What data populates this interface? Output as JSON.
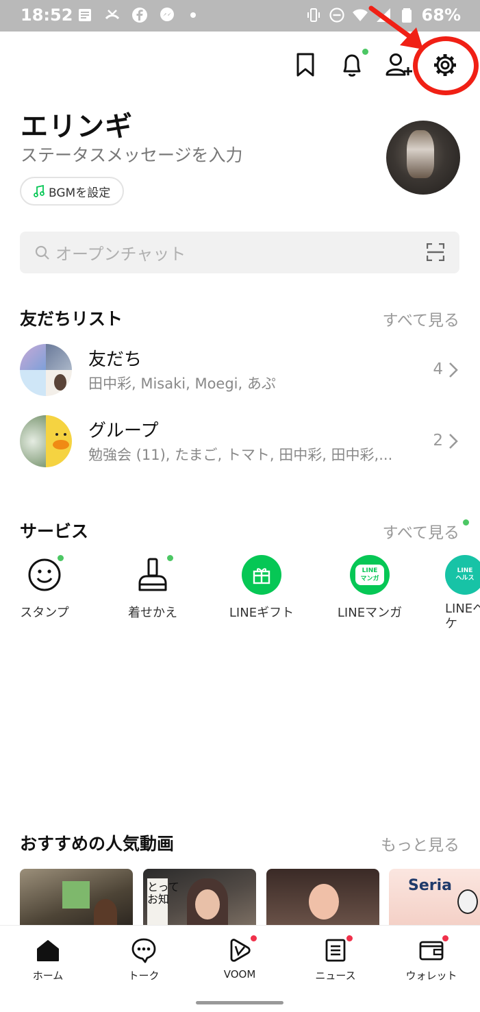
{
  "status_bar": {
    "time": "18:52",
    "battery": "68%",
    "left_icons": [
      "news-icon",
      "missed-call-icon",
      "facebook-icon",
      "messenger-icon",
      "dot"
    ],
    "right_icons": [
      "vibrate-icon",
      "dnd-icon",
      "wifi-icon",
      "signal-icon",
      "battery-icon"
    ]
  },
  "header_icons": [
    "bookmark-icon",
    "bell-icon",
    "add-friend-icon",
    "gear-icon"
  ],
  "profile": {
    "name": "エリンギ",
    "status_placeholder": "ステータスメッセージを入力",
    "bgm_label": "BGMを設定"
  },
  "search": {
    "placeholder": "オープンチャット"
  },
  "friends_section": {
    "title": "友だちリスト",
    "see_all": "すべて見る",
    "rows": [
      {
        "title": "友だち",
        "sub": "田中彩, Misaki, Moegi, あぷ",
        "count": "4"
      },
      {
        "title": "グループ",
        "sub": "勉強会 (11), たまご, トマト, 田中彩, 田中彩,...",
        "count": "2"
      }
    ]
  },
  "services_section": {
    "title": "サービス",
    "see_all": "すべて見る",
    "items": [
      {
        "label": "スタンプ",
        "icon": "smiley-icon"
      },
      {
        "label": "着せかえ",
        "icon": "brush-icon"
      },
      {
        "label": "LINEギフト",
        "icon": "gift-icon"
      },
      {
        "label": "LINEマンガ",
        "icon": "line-manga-icon",
        "icon_text": "LINE\nマンガ"
      },
      {
        "label": "LINEヘ\nケ",
        "icon": "line-health-icon",
        "icon_text": "LINE\nヘルス"
      }
    ]
  },
  "videos_section": {
    "title": "おすすめの人気動画",
    "see_more": "もっと見る",
    "thumb_texts": [
      "とって\nお知",
      "Seria"
    ]
  },
  "tabs": [
    {
      "label": "ホーム",
      "icon": "home-icon"
    },
    {
      "label": "トーク",
      "icon": "chat-icon"
    },
    {
      "label": "VOOM",
      "icon": "voom-icon"
    },
    {
      "label": "ニュース",
      "icon": "news-icon"
    },
    {
      "label": "ウォレット",
      "icon": "wallet-icon"
    }
  ],
  "colors": {
    "line_green": "#06c755",
    "notify_green": "#4cc764",
    "notify_red": "#f0304a",
    "annotation_red": "#f02015",
    "status_bar_bg": "#b9b9b9"
  }
}
